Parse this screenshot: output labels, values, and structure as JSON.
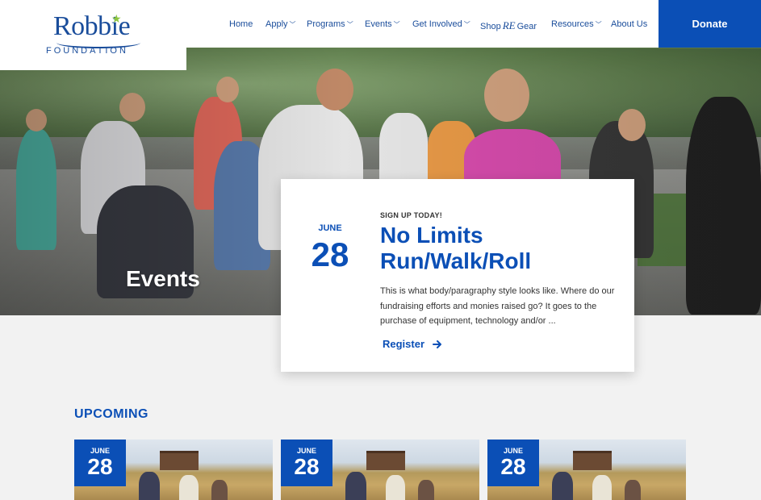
{
  "brand": {
    "name": "Robbie",
    "subtitle": "FOUNDATION"
  },
  "nav": {
    "items": [
      {
        "label": "Home",
        "has_menu": false
      },
      {
        "label": "Apply",
        "has_menu": true
      },
      {
        "label": "Programs",
        "has_menu": true
      },
      {
        "label": "Events",
        "has_menu": true
      },
      {
        "label": "Get Involved",
        "has_menu": true
      },
      {
        "label": "Shop",
        "has_menu": false
      },
      {
        "label": "Resources",
        "has_menu": true
      },
      {
        "label": "About Us",
        "has_menu": false
      }
    ],
    "shop_mark": "RE",
    "shop_suffix": "Gear",
    "donate_label": "Donate"
  },
  "hero": {
    "title": "Events"
  },
  "featured_event": {
    "month": "JUNE",
    "day": "28",
    "kicker": "SIGN UP TODAY!",
    "title": "No Limits Run/Walk/Roll",
    "body": "This is what body/paragraphy style looks like. Where do our fundraising efforts and monies raised go? It goes to the purchase of equipment, technology and/or ...",
    "cta_label": "Register"
  },
  "upcoming": {
    "heading": "UPCOMING",
    "cards": [
      {
        "month": "JUNE",
        "day": "28"
      },
      {
        "month": "JUNE",
        "day": "28"
      },
      {
        "month": "JUNE",
        "day": "28"
      }
    ]
  },
  "colors": {
    "brand_blue": "#0b4fb6",
    "logo_blue": "#1a4d9b",
    "logo_star": "#8cc63f",
    "page_bg": "#f2f2f2"
  }
}
